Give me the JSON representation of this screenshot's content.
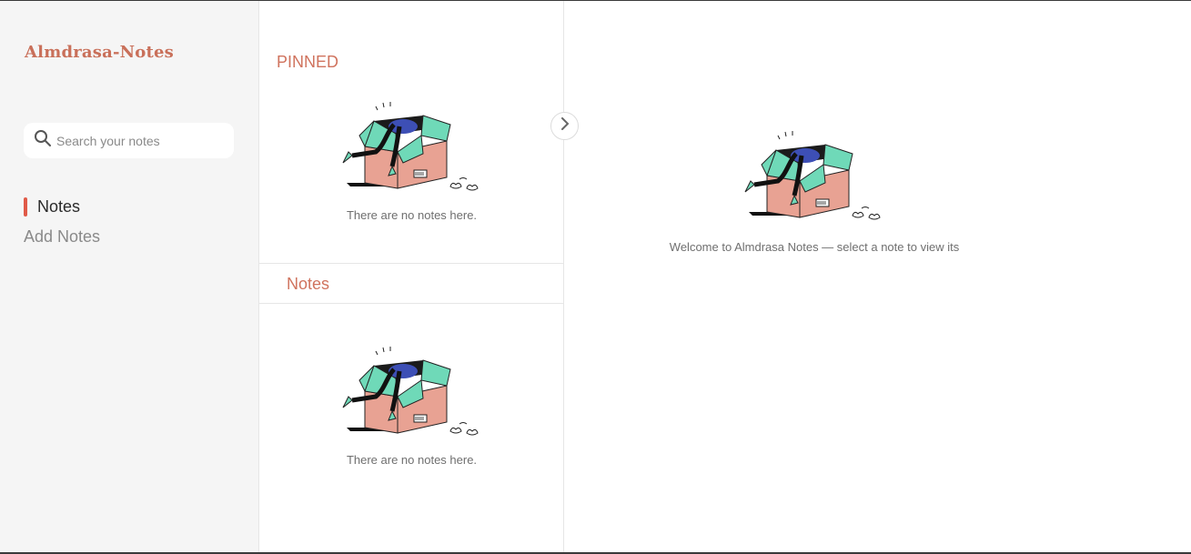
{
  "app": {
    "brand": "Almdrasa-Notes"
  },
  "search": {
    "placeholder": "Search your notes",
    "icon": "search-icon"
  },
  "nav": {
    "items": [
      {
        "label": "Notes",
        "active": true
      },
      {
        "label": "Add Notes",
        "active": false
      }
    ]
  },
  "list": {
    "pinned": {
      "title": "PINNED",
      "empty_text": "There are no notes here."
    },
    "notes": {
      "title": "Notes",
      "empty_text": "There are no notes here."
    }
  },
  "detail": {
    "welcome_text": "Welcome to Almdrasa Notes — select a note to view its"
  },
  "colors": {
    "accent": "#d0735e",
    "active_bar": "#e05a48",
    "sidebar_bg": "#f5f5f5",
    "box": "#e8a293",
    "box_flap": "#6fd9b8"
  }
}
